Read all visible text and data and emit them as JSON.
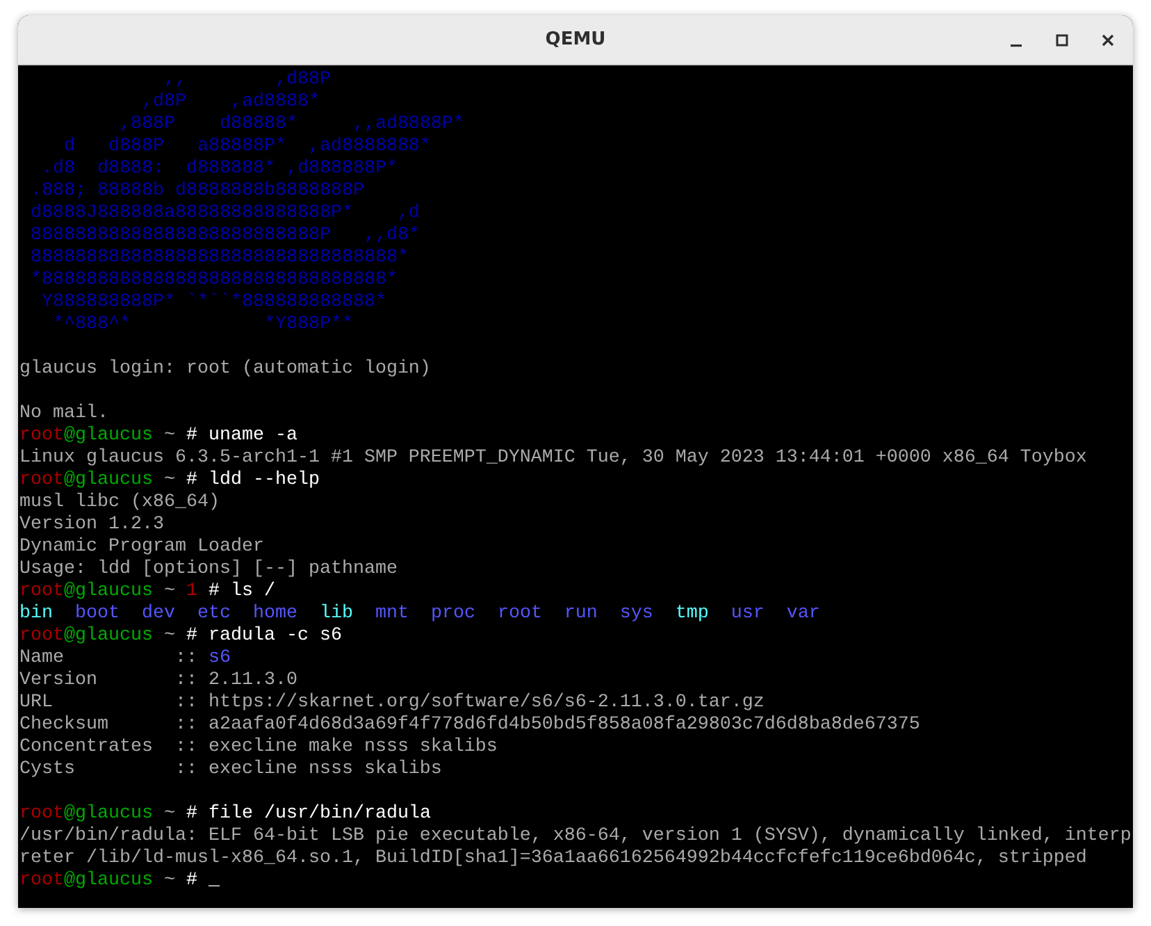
{
  "window": {
    "title": "QEMU"
  },
  "terminal": {
    "lines": [
      {
        "kind": "text",
        "segments": [
          {
            "text": "             ,,        ,d88P",
            "color": "#0000aa"
          }
        ]
      },
      {
        "kind": "text",
        "segments": [
          {
            "text": "           ,d8P    ,ad8888*",
            "color": "#0000aa"
          }
        ]
      },
      {
        "kind": "text",
        "segments": [
          {
            "text": "         ,888P    d88888*     ,,ad8888P*",
            "color": "#0000aa"
          }
        ]
      },
      {
        "kind": "text",
        "segments": [
          {
            "text": "    d   d888P   a88888P*  ,ad8888888*",
            "color": "#0000aa"
          }
        ]
      },
      {
        "kind": "text",
        "segments": [
          {
            "text": "  .d8  d8888:  d888888* ,d888888P*",
            "color": "#0000aa"
          }
        ]
      },
      {
        "kind": "text",
        "segments": [
          {
            "text": " .888; 88888b d8888888b8888888P",
            "color": "#0000aa"
          }
        ]
      },
      {
        "kind": "text",
        "segments": [
          {
            "text": " d8888J888888a88888888888888P*    ,d",
            "color": "#0000aa"
          }
        ]
      },
      {
        "kind": "text",
        "segments": [
          {
            "text": " 88888888888888888888888888P   ,,d8*",
            "color": "#0000aa"
          }
        ]
      },
      {
        "kind": "text",
        "segments": [
          {
            "text": " 888888888888888888888888888888888*",
            "color": "#0000aa"
          }
        ]
      },
      {
        "kind": "text",
        "segments": [
          {
            "text": " *8888888888888888888888888888888*",
            "color": "#0000aa"
          }
        ]
      },
      {
        "kind": "text",
        "segments": [
          {
            "text": "  Y888888888P* `*``*888888888888*",
            "color": "#0000aa"
          }
        ]
      },
      {
        "kind": "text",
        "segments": [
          {
            "text": "   *^888^*            *Y888P**",
            "color": "#0000aa"
          }
        ]
      },
      {
        "kind": "blank"
      },
      {
        "kind": "text",
        "segments": [
          {
            "text": "glaucus login: root (automatic login)",
            "color": "#aaaaaa"
          }
        ]
      },
      {
        "kind": "blank"
      },
      {
        "kind": "text",
        "segments": [
          {
            "text": "No mail.",
            "color": "#aaaaaa"
          }
        ]
      },
      {
        "kind": "text",
        "segments": [
          {
            "text": "root",
            "color": "#aa0000"
          },
          {
            "text": "@glaucus",
            "color": "#00aa00"
          },
          {
            "text": " ~ ",
            "color": "#aaaaaa"
          },
          {
            "text": "# uname -a",
            "color": "#ffffff"
          }
        ]
      },
      {
        "kind": "text",
        "segments": [
          {
            "text": "Linux glaucus 6.3.5-arch1-1 #1 SMP PREEMPT_DYNAMIC Tue, 30 May 2023 13:44:01 +0000 x86_64 Toybox",
            "color": "#aaaaaa"
          }
        ]
      },
      {
        "kind": "text",
        "segments": [
          {
            "text": "root",
            "color": "#aa0000"
          },
          {
            "text": "@glaucus",
            "color": "#00aa00"
          },
          {
            "text": " ~ ",
            "color": "#aaaaaa"
          },
          {
            "text": "# ldd --help",
            "color": "#ffffff"
          }
        ]
      },
      {
        "kind": "text",
        "segments": [
          {
            "text": "musl libc (x86_64)",
            "color": "#aaaaaa"
          }
        ]
      },
      {
        "kind": "text",
        "segments": [
          {
            "text": "Version 1.2.3",
            "color": "#aaaaaa"
          }
        ]
      },
      {
        "kind": "text",
        "segments": [
          {
            "text": "Dynamic Program Loader",
            "color": "#aaaaaa"
          }
        ]
      },
      {
        "kind": "text",
        "segments": [
          {
            "text": "Usage: ldd [options] [--] pathname",
            "color": "#aaaaaa"
          }
        ]
      },
      {
        "kind": "text",
        "segments": [
          {
            "text": "root",
            "color": "#aa0000"
          },
          {
            "text": "@glaucus",
            "color": "#00aa00"
          },
          {
            "text": " ~ ",
            "color": "#aaaaaa"
          },
          {
            "text": "1",
            "color": "#aa0000"
          },
          {
            "text": " # ls /",
            "color": "#ffffff"
          }
        ]
      },
      {
        "kind": "text",
        "segments": [
          {
            "text": "bin",
            "color": "#55ffff"
          },
          {
            "text": "  boot  dev  etc  home",
            "color": "#5555ff"
          },
          {
            "text": "  lib",
            "color": "#55ffff"
          },
          {
            "text": "  mnt  proc  root  run  sys",
            "color": "#5555ff"
          },
          {
            "text": "  tmp",
            "color": "#55ffff"
          },
          {
            "text": "  usr  var",
            "color": "#5555ff"
          }
        ]
      },
      {
        "kind": "text",
        "segments": [
          {
            "text": "root",
            "color": "#aa0000"
          },
          {
            "text": "@glaucus",
            "color": "#00aa00"
          },
          {
            "text": " ~ ",
            "color": "#aaaaaa"
          },
          {
            "text": "# radula -c s6",
            "color": "#ffffff"
          }
        ]
      },
      {
        "kind": "text",
        "segments": [
          {
            "text": "Name          :: ",
            "color": "#aaaaaa"
          },
          {
            "text": "s6",
            "color": "#5555ff"
          }
        ]
      },
      {
        "kind": "text",
        "segments": [
          {
            "text": "Version       :: 2.11.3.0",
            "color": "#aaaaaa"
          }
        ]
      },
      {
        "kind": "text",
        "segments": [
          {
            "text": "URL           :: https://skarnet.org/software/s6/s6-2.11.3.0.tar.gz",
            "color": "#aaaaaa"
          }
        ]
      },
      {
        "kind": "text",
        "segments": [
          {
            "text": "Checksum      :: a2aafa0f4d68d3a69f4f778d6fd4b50bd5f858a08fa29803c7d6d8ba8de67375",
            "color": "#aaaaaa"
          }
        ]
      },
      {
        "kind": "text",
        "segments": [
          {
            "text": "Concentrates  :: execline make nsss skalibs",
            "color": "#aaaaaa"
          }
        ]
      },
      {
        "kind": "text",
        "segments": [
          {
            "text": "Cysts         :: execline nsss skalibs",
            "color": "#aaaaaa"
          }
        ]
      },
      {
        "kind": "blank"
      },
      {
        "kind": "text",
        "segments": [
          {
            "text": "root",
            "color": "#aa0000"
          },
          {
            "text": "@glaucus",
            "color": "#00aa00"
          },
          {
            "text": " ~ ",
            "color": "#aaaaaa"
          },
          {
            "text": "# file /usr/bin/radula",
            "color": "#ffffff"
          }
        ]
      },
      {
        "kind": "text",
        "segments": [
          {
            "text": "/usr/bin/radula: ELF 64-bit LSB pie executable, x86-64, version 1 (SYSV), dynamically linked, interp",
            "color": "#aaaaaa"
          }
        ]
      },
      {
        "kind": "text",
        "segments": [
          {
            "text": "reter /lib/ld-musl-x86_64.so.1, BuildID[sha1]=36a1aa66162564992b44ccfcfefc119ce6bd064c, stripped",
            "color": "#aaaaaa"
          }
        ]
      },
      {
        "kind": "text",
        "segments": [
          {
            "text": "root",
            "color": "#aa0000"
          },
          {
            "text": "@glaucus",
            "color": "#00aa00"
          },
          {
            "text": " ~ ",
            "color": "#aaaaaa"
          },
          {
            "text": "# _",
            "color": "#ffffff"
          }
        ]
      }
    ]
  }
}
